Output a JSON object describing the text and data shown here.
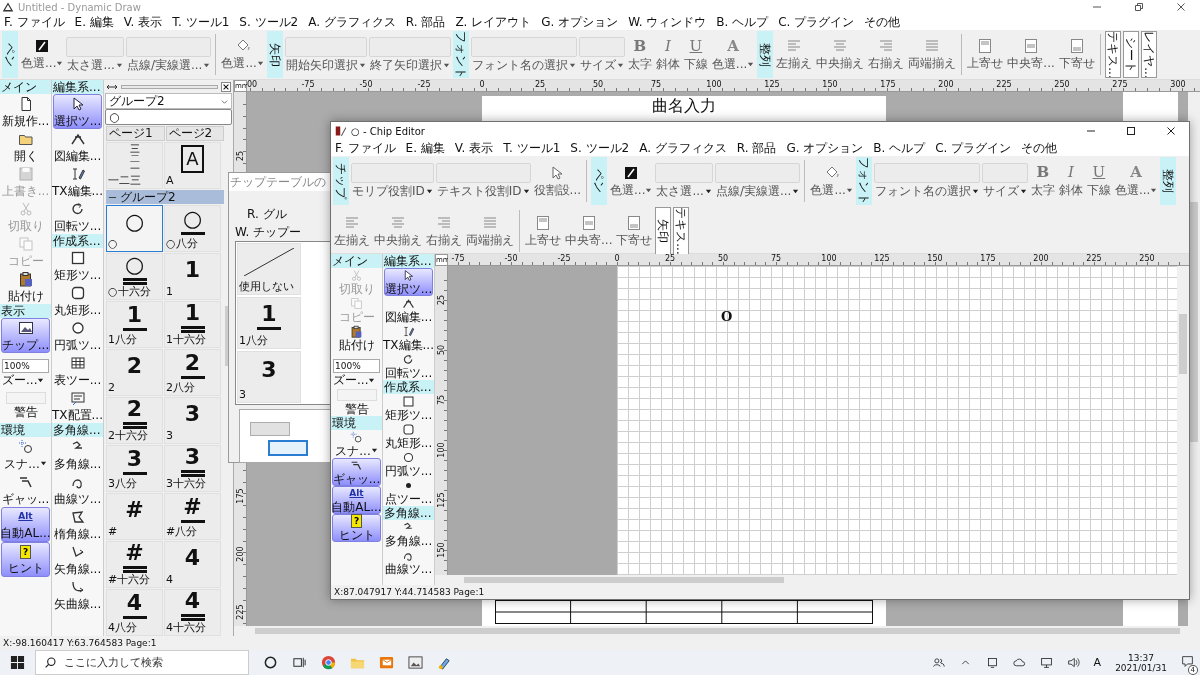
{
  "window": {
    "title": "Untitled - Dynamic Draw"
  },
  "menu": [
    "F. ファイル",
    "E. 編集",
    "V. 表示",
    "T. ツール1",
    "S. ツール2",
    "A. グラフィクス",
    "R. 部品",
    "Z. レイアウト",
    "G. オプション",
    "W. ウィンドウ",
    "B. ヘルプ",
    "C. プラグイン",
    "その他"
  ],
  "toolbar": [
    {
      "kind": "label",
      "label": "ペン"
    },
    {
      "kind": "pencolor",
      "label": "色選...",
      "menu": true
    },
    {
      "kind": "combo",
      "label": "太さ選..."
    },
    {
      "kind": "combo",
      "label": "点線/実線選..."
    },
    {
      "kind": "sep"
    },
    {
      "kind": "fill",
      "label": "色選...",
      "menu": true
    },
    {
      "kind": "label",
      "label": "矢印"
    },
    {
      "kind": "combo",
      "label": "開始矢印選択"
    },
    {
      "kind": "combo",
      "label": "終了矢印選択"
    },
    {
      "kind": "label",
      "label": "フォント"
    },
    {
      "kind": "combo",
      "label": "フォント名の選択"
    },
    {
      "kind": "combo",
      "label": "サイズ"
    },
    {
      "kind": "glyph",
      "glyph": "B",
      "label": "太字"
    },
    {
      "kind": "glyph",
      "glyph": "I",
      "label": "斜体"
    },
    {
      "kind": "glyph",
      "glyph": "U",
      "label": "下線"
    },
    {
      "kind": "glyph",
      "glyph": "A",
      "label": "色選...",
      "menu": true
    },
    {
      "kind": "label",
      "label": "整列"
    },
    {
      "kind": "align-left",
      "label": "左揃え"
    },
    {
      "kind": "align-center",
      "label": "中央揃え"
    },
    {
      "kind": "align-right",
      "label": "右揃え"
    },
    {
      "kind": "justify",
      "label": "両端揃え"
    },
    {
      "kind": "sep"
    },
    {
      "kind": "top",
      "label": "上寄せ"
    },
    {
      "kind": "middle",
      "label": "中央寄..."
    },
    {
      "kind": "bottom",
      "label": "下寄せ"
    },
    {
      "kind": "sep"
    },
    {
      "kind": "tab",
      "label": "テキス..."
    },
    {
      "kind": "tab",
      "label": "シート"
    },
    {
      "kind": "tab",
      "label": "レイヤ..."
    }
  ],
  "palette_main": [
    {
      "kind": "header",
      "label": "メイン"
    },
    {
      "kind": "new",
      "label": "新規作...",
      "selected": false,
      "disabled": false
    },
    {
      "kind": "open",
      "label": "開く",
      "selected": false,
      "disabled": false
    },
    {
      "kind": "save",
      "label": "上書き...",
      "selected": false,
      "disabled": true
    },
    {
      "kind": "cut",
      "label": "切取り",
      "selected": false,
      "disabled": true
    },
    {
      "kind": "copy",
      "label": "コピー",
      "selected": false,
      "disabled": true
    },
    {
      "kind": "paste",
      "label": "貼付け",
      "selected": false,
      "disabled": false
    },
    {
      "kind": "header",
      "label": "表示"
    },
    {
      "kind": "chip",
      "label": "チップ...",
      "selected": true,
      "disabled": false
    },
    {
      "kind": "zoom",
      "value": "100%",
      "label": "ズー..."
    },
    {
      "kind": "warn",
      "label": "警告"
    },
    {
      "kind": "header",
      "label": "環境"
    },
    {
      "kind": "snap",
      "label": "スナ...",
      "selected": false,
      "disabled": false
    },
    {
      "kind": "gap",
      "label": "ギャッ...",
      "selected": false,
      "disabled": false
    },
    {
      "kind": "alt",
      "glyph": "Alt",
      "label": "自動AL...",
      "selected": true,
      "disabled": false
    },
    {
      "kind": "hint",
      "glyph": "?",
      "label": "ヒント",
      "selected": true,
      "disabled": false
    }
  ],
  "palette_edit": [
    {
      "kind": "header",
      "label": "編集系..."
    },
    {
      "kind": "select",
      "label": "選択ツ...",
      "selected": true,
      "disabled": false
    },
    {
      "kind": "shapeedit",
      "label": "図編集...",
      "selected": false,
      "disabled": false
    },
    {
      "kind": "txedit",
      "label": "TX編集...",
      "selected": false,
      "disabled": false
    },
    {
      "kind": "rotate",
      "label": "回転ツ...",
      "selected": false,
      "disabled": false
    },
    {
      "kind": "header",
      "label": "作成系..."
    },
    {
      "kind": "rect",
      "label": "矩形ツ...",
      "selected": false,
      "disabled": false
    },
    {
      "kind": "rrect",
      "label": "丸矩形...",
      "selected": false,
      "disabled": false
    },
    {
      "kind": "arc",
      "label": "円弧ツ...",
      "selected": false,
      "disabled": false
    },
    {
      "kind": "table",
      "label": "表ツー...",
      "selected": false,
      "disabled": false
    },
    {
      "kind": "txplace",
      "label": "TX配置...",
      "selected": false,
      "disabled": false
    },
    {
      "kind": "header",
      "label": "多角線..."
    },
    {
      "kind": "poly",
      "label": "多角線...",
      "selected": false,
      "disabled": false
    },
    {
      "kind": "curve",
      "label": "曲線ツ...",
      "selected": false,
      "disabled": false
    },
    {
      "kind": "polyangle",
      "label": "楕角線...",
      "selected": false,
      "disabled": false
    },
    {
      "kind": "arrowangle",
      "label": "矢角線...",
      "selected": false,
      "disabled": false
    },
    {
      "kind": "arrowcurve",
      "label": "矢曲線...",
      "selected": false,
      "disabled": false
    }
  ],
  "chip_panel": {
    "group_select": "グループ2",
    "filter": "○",
    "pages": [
      {
        "label": "ページ1",
        "selected": false
      },
      {
        "label": "ページ2",
        "selected": false
      }
    ],
    "top_chips": [
      {
        "kind": "stack",
        "symbol": "三二一",
        "caption": "一二三",
        "selected": false
      },
      {
        "kind": "boxed",
        "symbol": "A",
        "caption": "A",
        "selected": false
      }
    ],
    "group": {
      "label": "グループ2",
      "expanded": true,
      "chips": [
        {
          "kind": "plain",
          "symbol": "○",
          "caption": "○",
          "selected": true
        },
        {
          "kind": "eighth",
          "symbol": "○",
          "caption": "○八分",
          "selected": false
        },
        {
          "kind": "sixteenth",
          "symbol": "○",
          "caption": "○十六分",
          "selected": false
        },
        {
          "kind": "plain",
          "symbol": "1",
          "caption": "1",
          "selected": false
        },
        {
          "kind": "eighth",
          "symbol": "1",
          "caption": "1八分",
          "selected": false
        },
        {
          "kind": "sixteenth",
          "symbol": "1",
          "caption": "1十六分",
          "selected": false
        },
        {
          "kind": "plain",
          "symbol": "2",
          "caption": "2",
          "selected": false
        },
        {
          "kind": "eighth",
          "symbol": "2",
          "caption": "2八分",
          "selected": false
        },
        {
          "kind": "sixteenth",
          "symbol": "2",
          "caption": "2十六分",
          "selected": false
        },
        {
          "kind": "plain",
          "symbol": "3",
          "caption": "3",
          "selected": false
        },
        {
          "kind": "eighth",
          "symbol": "3",
          "caption": "3八分",
          "selected": false
        },
        {
          "kind": "sixteenth",
          "symbol": "3",
          "caption": "3十六分",
          "selected": false
        },
        {
          "kind": "plain",
          "symbol": "#",
          "caption": "#",
          "selected": false
        },
        {
          "kind": "eighth",
          "symbol": "#",
          "caption": "#八分",
          "selected": false
        },
        {
          "kind": "sixteenth",
          "symbol": "#",
          "caption": "#十六分",
          "selected": false
        },
        {
          "kind": "plain",
          "symbol": "4",
          "caption": "4",
          "selected": false
        },
        {
          "kind": "eighth",
          "symbol": "4",
          "caption": "4八分",
          "selected": false
        },
        {
          "kind": "sixteenth",
          "symbol": "4",
          "caption": "4十六分",
          "selected": false
        }
      ]
    }
  },
  "ruler_unit": "mm",
  "ruler_h": [
    "00",
    "-75",
    "-50",
    "-25",
    "0",
    "25",
    "50",
    "75",
    "100",
    "125",
    "150",
    "175",
    "200",
    "225",
    "250",
    "275",
    "300"
  ],
  "ruler_v": {
    "upper": [
      "25"
    ],
    "lower": [
      "175",
      "200",
      "225"
    ]
  },
  "page": {
    "title": "曲名入力"
  },
  "status": "X:-98.160417 Y:63.764583 Page:1",
  "dialog": {
    "title": "チップテーブルの",
    "labels": [
      "R. グル",
      "W. チップー"
    ],
    "cells": [
      {
        "kind": "none",
        "caption": "使用しない"
      },
      {
        "kind": "eighth",
        "symbol": "1",
        "caption": "1八分"
      },
      {
        "kind": "plain",
        "symbol": "3",
        "caption": "3"
      }
    ]
  },
  "editor": {
    "title": "○ - Chip Editor",
    "menu": [
      "F. ファイル",
      "E. 編集",
      "V. 表示",
      "T. ツール1",
      "S. ツール2",
      "A. グラフィクス",
      "R. 部品",
      "G. オプション",
      "B. ヘルプ",
      "C. プラグイン",
      "その他"
    ],
    "toolbar": [
      {
        "kind": "label",
        "label": "チップ"
      },
      {
        "kind": "combo",
        "label": "モリプ役割ID"
      },
      {
        "kind": "combo",
        "label": "テキスト役割ID"
      },
      {
        "kind": "cursor",
        "label": "役割設..."
      },
      {
        "kind": "sep"
      },
      {
        "kind": "label",
        "label": "ペン"
      },
      {
        "kind": "pencolor",
        "label": "色選...",
        "menu": true
      },
      {
        "kind": "combo",
        "label": "太さ選..."
      },
      {
        "kind": "combo",
        "label": "点線/実線選..."
      },
      {
        "kind": "sep"
      },
      {
        "kind": "fill",
        "label": "色選...",
        "menu": true
      },
      {
        "kind": "label",
        "label": "フォント"
      },
      {
        "kind": "combo",
        "label": "フォント名の選択"
      },
      {
        "kind": "combo",
        "label": "サイズ"
      },
      {
        "kind": "glyph",
        "glyph": "B",
        "label": "太字"
      },
      {
        "kind": "glyph",
        "glyph": "I",
        "label": "斜体"
      },
      {
        "kind": "glyph",
        "glyph": "U",
        "label": "下線"
      },
      {
        "kind": "glyph",
        "glyph": "A",
        "label": "色選...",
        "menu": true
      },
      {
        "kind": "label",
        "label": "整列"
      },
      {
        "kind": "align-left",
        "label": "左揃え"
      },
      {
        "kind": "align-center",
        "label": "中央揃え"
      },
      {
        "kind": "align-right",
        "label": "右揃え"
      },
      {
        "kind": "justify",
        "label": "両端揃え"
      },
      {
        "kind": "sep"
      },
      {
        "kind": "top",
        "label": "上寄せ"
      },
      {
        "kind": "middle",
        "label": "中央寄..."
      },
      {
        "kind": "bottom",
        "label": "下寄せ"
      },
      {
        "kind": "tab",
        "label": "矢印"
      },
      {
        "kind": "tab",
        "label": "テキス..."
      }
    ],
    "palette_main": [
      {
        "kind": "header",
        "label": "メイン"
      },
      {
        "kind": "cut",
        "label": "切取り",
        "selected": false,
        "disabled": true
      },
      {
        "kind": "copy",
        "label": "コピー",
        "selected": false,
        "disabled": true
      },
      {
        "kind": "paste",
        "label": "貼付け",
        "selected": false,
        "disabled": false
      },
      {
        "kind": "zoom",
        "value": "100%",
        "label": "ズー..."
      },
      {
        "kind": "warn",
        "label": "警告"
      },
      {
        "kind": "header",
        "label": "環境"
      },
      {
        "kind": "snap",
        "label": "スナ...",
        "selected": false,
        "disabled": false
      },
      {
        "kind": "gap",
        "label": "ギャッ...",
        "selected": true,
        "disabled": false
      },
      {
        "kind": "alt",
        "glyph": "Alt",
        "label": "自動AL...",
        "selected": true,
        "disabled": false
      },
      {
        "kind": "hint",
        "glyph": "?",
        "label": "ヒント",
        "selected": true,
        "disabled": false
      }
    ],
    "palette_edit": [
      {
        "kind": "header",
        "label": "編集系..."
      },
      {
        "kind": "select",
        "label": "選択ツ...",
        "selected": true,
        "disabled": false
      },
      {
        "kind": "shapeedit",
        "label": "図編集...",
        "selected": false,
        "disabled": false
      },
      {
        "kind": "txedit",
        "label": "TX編集...",
        "selected": false,
        "disabled": false
      },
      {
        "kind": "rotate",
        "label": "回転ツ...",
        "selected": false,
        "disabled": false
      },
      {
        "kind": "header",
        "label": "作成系..."
      },
      {
        "kind": "rect",
        "label": "矩形ツ...",
        "selected": false,
        "disabled": false
      },
      {
        "kind": "rrect",
        "label": "丸矩形...",
        "selected": false,
        "disabled": false
      },
      {
        "kind": "arc",
        "label": "円弧ツ...",
        "selected": false,
        "disabled": false
      },
      {
        "kind": "point",
        "label": "点ツー...",
        "selected": false,
        "disabled": false
      },
      {
        "kind": "header",
        "label": "多角線..."
      },
      {
        "kind": "poly",
        "label": "多角線...",
        "selected": false,
        "disabled": false
      },
      {
        "kind": "curve",
        "label": "曲線ツ...",
        "selected": false,
        "disabled": false
      }
    ],
    "ruler_unit": "mm",
    "ruler_h": [
      "-75",
      "-50",
      "-25",
      "0",
      "25",
      "50",
      "75",
      "100",
      "125",
      "150",
      "175",
      "200",
      "225",
      "250"
    ],
    "ruler_v": [
      "25",
      "50",
      "75",
      "100",
      "125",
      "150"
    ],
    "canvas_text": "O",
    "status": "X:87.047917 Y:44.714583 Page:1"
  },
  "taskbar": {
    "search": {
      "placeholder": "ここに入力して検索"
    },
    "apps": [
      {
        "kind": "cortana"
      },
      {
        "kind": "taskview"
      },
      {
        "kind": "browser"
      },
      {
        "kind": "folder"
      },
      {
        "kind": "mail"
      },
      {
        "kind": "photo"
      },
      {
        "kind": "paint"
      }
    ],
    "ime": "A",
    "time": "13:37",
    "date": "2021/01/31",
    "notifications": "4"
  }
}
